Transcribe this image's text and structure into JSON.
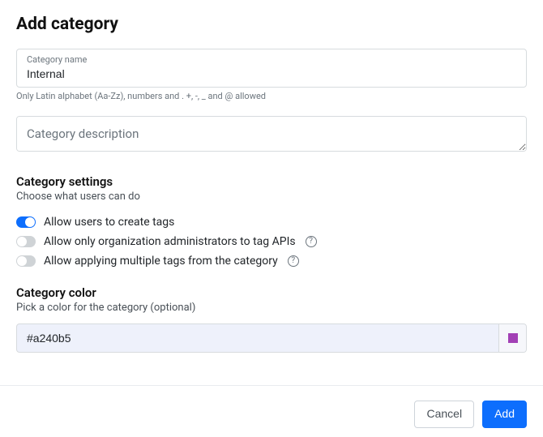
{
  "title": "Add category",
  "name_field": {
    "label": "Category name",
    "value": "Internal",
    "hint": "Only Latin alphabet (Aa-Zz), numbers and . +, -, _ and @ allowed"
  },
  "description_field": {
    "placeholder": "Category description",
    "value": ""
  },
  "settings": {
    "title": "Category settings",
    "subtitle": "Choose what users can do",
    "toggles": [
      {
        "label": "Allow users to create tags",
        "on": true,
        "help": false
      },
      {
        "label": "Allow only organization administrators to tag APIs",
        "on": false,
        "help": true
      },
      {
        "label": "Allow applying multiple tags from the category",
        "on": false,
        "help": true
      }
    ]
  },
  "color": {
    "title": "Category color",
    "subtitle": "Pick a color for the category (optional)",
    "value": "#a240b5"
  },
  "actions": {
    "cancel": "Cancel",
    "add": "Add"
  }
}
